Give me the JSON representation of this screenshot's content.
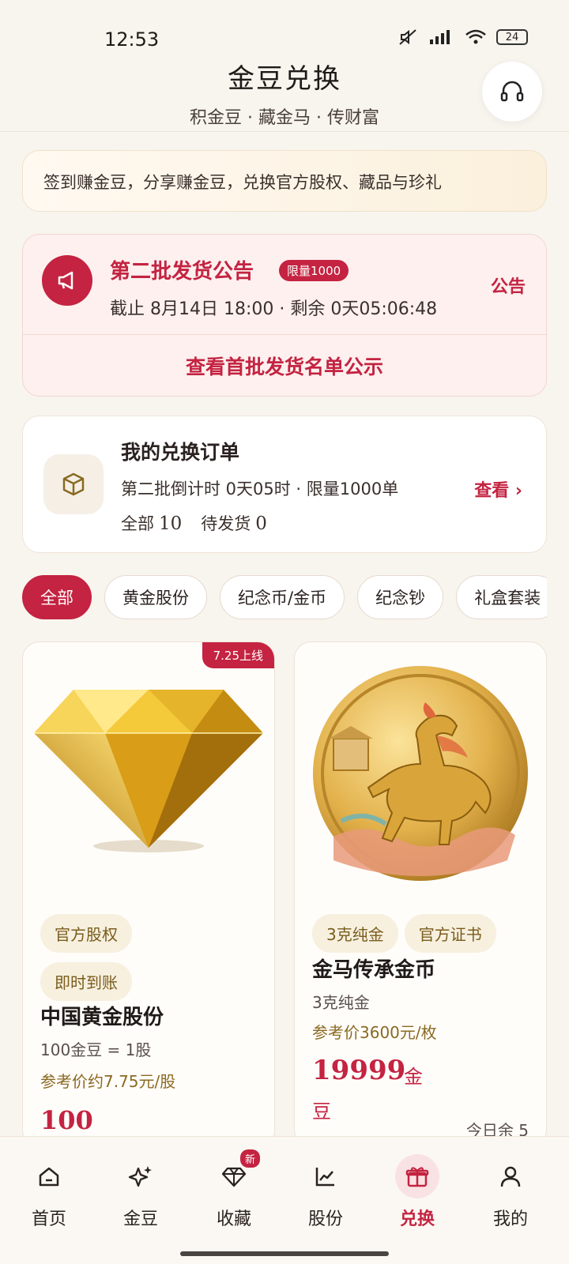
{
  "status_bar": {
    "time": "12:53",
    "battery": "24"
  },
  "header": {
    "title": "金豆兑换",
    "subtitle": "积金豆 · 藏金马 · 传财富"
  },
  "promo": {
    "text": "签到赚金豆，分享赚金豆，兑换官方股权、藏品与珍礼"
  },
  "announcement": {
    "title": "第二批发货公告",
    "badge": "限量1000",
    "meta": "截止 8月14日 18:00 · 剩余 0天05:06:48",
    "link": "公告",
    "footer": "查看首批发货名单公示"
  },
  "orders": {
    "title": "我的兑换订单",
    "meta": "第二批倒计时 0天05时 · 限量1000单",
    "view": "查看 ›",
    "all_label": "全部",
    "all_count": "10",
    "pending_label": "待发货",
    "pending_count": "0"
  },
  "tabs": [
    "全部",
    "黄金股份",
    "纪念币/金币",
    "纪念钞",
    "礼盒套装"
  ],
  "products": [
    {
      "badge": "7.25上线",
      "chips": [
        "官方股权",
        "即时到账"
      ],
      "name": "中国黄金股份",
      "line": "100金豆 = 1股",
      "ref": "参考价约7.75元/股",
      "price_partial": "100"
    },
    {
      "chips": [
        "3克纯金",
        "官方证书"
      ],
      "name": "金马传承金币",
      "line": "3克纯金",
      "ref": "参考价3600元/枚",
      "price": "19999",
      "price_unit": "金",
      "price_unit2": "豆",
      "remain": "今日余 5"
    }
  ],
  "nav": [
    {
      "label": "首页",
      "icon": "home-icon"
    },
    {
      "label": "金豆",
      "icon": "sparkle-icon"
    },
    {
      "label": "收藏",
      "icon": "diamond-icon",
      "badge": "新"
    },
    {
      "label": "股份",
      "icon": "chart-icon"
    },
    {
      "label": "兑换",
      "icon": "gift-icon",
      "active": true
    },
    {
      "label": "我的",
      "icon": "user-icon"
    }
  ],
  "colors": {
    "accent": "#c42341",
    "gold": "#d4a21e",
    "background": "#f8f4ee"
  }
}
